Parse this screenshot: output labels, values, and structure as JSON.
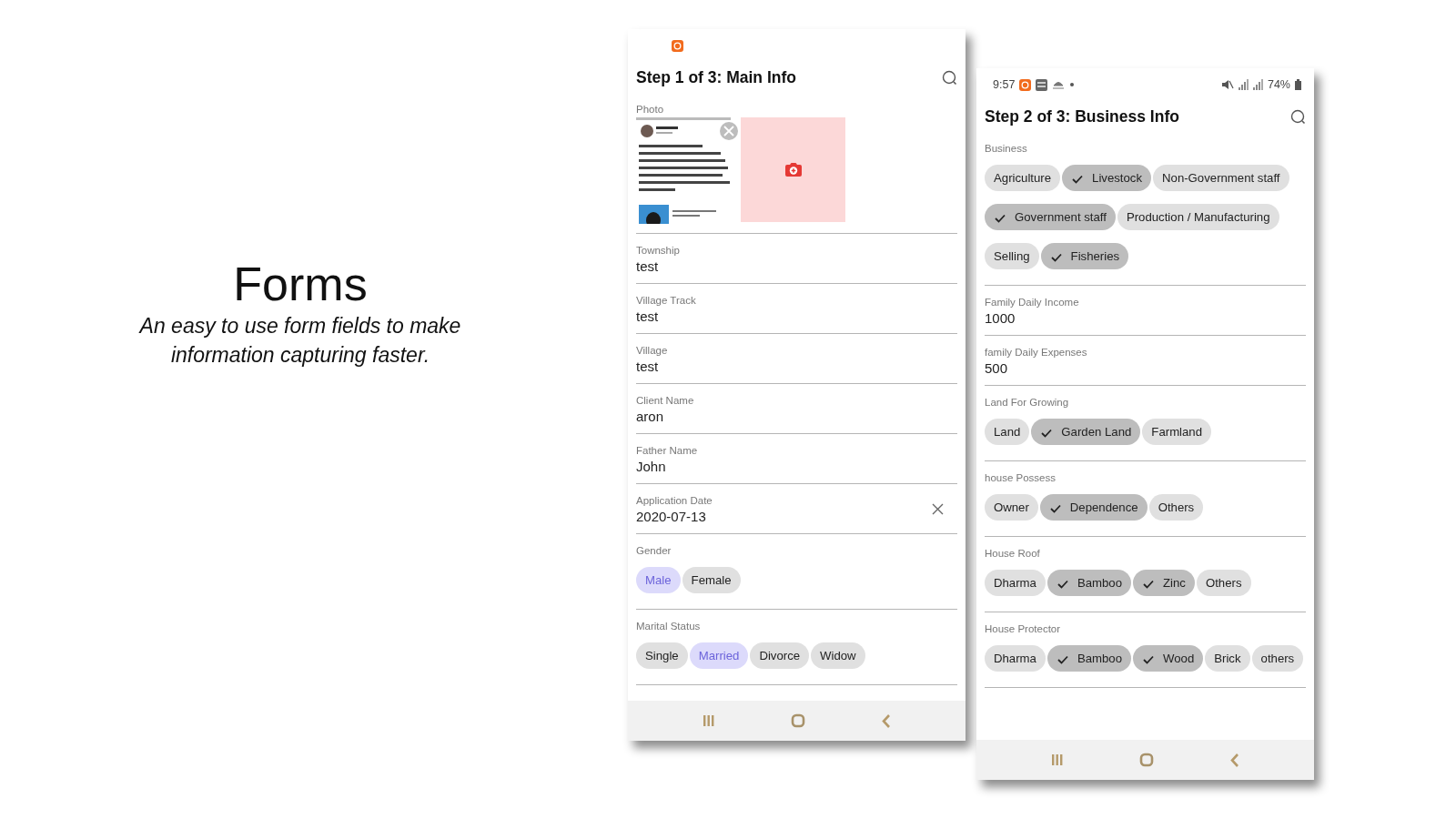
{
  "slide": {
    "title": "Forms",
    "subtitle": "An easy to use form fields to make information capturing faster."
  },
  "screens": [
    {
      "title": "Step 1 of 3: Main Info",
      "sections": [
        {
          "label": "Photo"
        },
        {
          "kind": "text",
          "label": "Township",
          "value": "test"
        },
        {
          "kind": "text",
          "label": "Village Track",
          "value": "test"
        },
        {
          "kind": "text",
          "label": "Village",
          "value": "test"
        },
        {
          "kind": "text",
          "label": "Client Name",
          "value": "aron"
        },
        {
          "kind": "text",
          "label": "Father Name",
          "value": "John"
        },
        {
          "kind": "date",
          "label": "Application Date",
          "value": "2020-07-13"
        },
        {
          "kind": "single",
          "label": "Gender",
          "options": [
            {
              "label": "Male",
              "selected": true
            },
            {
              "label": "Female",
              "selected": false
            }
          ]
        },
        {
          "kind": "single",
          "label": "Marital Status",
          "options": [
            {
              "label": "Single",
              "selected": false
            },
            {
              "label": "Married",
              "selected": true
            },
            {
              "label": "Divorce",
              "selected": false
            },
            {
              "label": "Widow",
              "selected": false
            }
          ]
        }
      ]
    },
    {
      "status_bar": {
        "time": "9:57",
        "battery": "74%"
      },
      "title": "Step 2 of 3: Business Info",
      "sections": [
        {
          "kind": "multi",
          "label": "Business",
          "options": [
            {
              "label": "Agriculture",
              "checked": false
            },
            {
              "label": "Livestock",
              "checked": true
            },
            {
              "label": "Non-Government staff",
              "checked": false
            },
            {
              "label": "Government staff",
              "checked": true
            },
            {
              "label": "Production / Manufacturing",
              "checked": false
            },
            {
              "label": "Selling",
              "checked": false
            },
            {
              "label": "Fisheries",
              "checked": true
            }
          ]
        },
        {
          "kind": "text",
          "label": "Family Daily Income",
          "value": "1000"
        },
        {
          "kind": "text",
          "label": "family Daily Expenses",
          "value": "500"
        },
        {
          "kind": "multi",
          "label": "Land For Growing",
          "options": [
            {
              "label": "Land",
              "checked": false
            },
            {
              "label": "Garden Land",
              "checked": true
            },
            {
              "label": "Farmland",
              "checked": false
            }
          ]
        },
        {
          "kind": "multi",
          "label": "house Possess",
          "options": [
            {
              "label": "Owner",
              "checked": false
            },
            {
              "label": "Dependence",
              "checked": true
            },
            {
              "label": "Others",
              "checked": false
            }
          ]
        },
        {
          "kind": "multi",
          "label": "House Roof",
          "options": [
            {
              "label": "Dharma",
              "checked": false
            },
            {
              "label": "Bamboo",
              "checked": true
            },
            {
              "label": "Zinc",
              "checked": true
            },
            {
              "label": "Others",
              "checked": false
            }
          ]
        },
        {
          "kind": "multi",
          "label": "House Protector",
          "options": [
            {
              "label": "Dharma",
              "checked": false
            },
            {
              "label": "Bamboo",
              "checked": true
            },
            {
              "label": "Wood",
              "checked": true
            },
            {
              "label": "Brick",
              "checked": false
            },
            {
              "label": "others",
              "checked": false
            }
          ]
        }
      ]
    }
  ]
}
